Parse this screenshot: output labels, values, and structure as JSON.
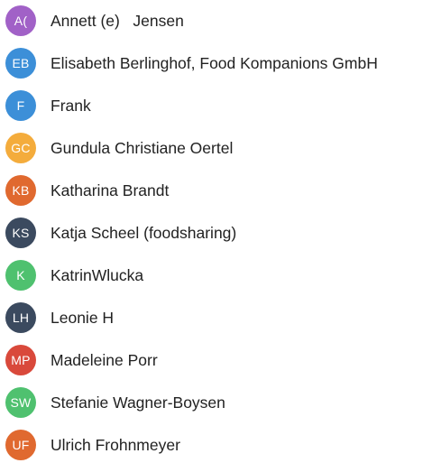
{
  "contacts": [
    {
      "initials": "A(",
      "name": "Annett (e)   Jensen",
      "color": "#a161c7"
    },
    {
      "initials": "EB",
      "name": "Elisabeth Berlinghof, Food Kompanions GmbH",
      "color": "#3c8fd8"
    },
    {
      "initials": "F",
      "name": "Frank",
      "color": "#3c8fd8"
    },
    {
      "initials": "GC",
      "name": "Gundula Christiane Oertel",
      "color": "#f4ac3c"
    },
    {
      "initials": "KB",
      "name": "Katharina Brandt",
      "color": "#e0692f"
    },
    {
      "initials": "KS",
      "name": "Katja Scheel (foodsharing)",
      "color": "#3b4a5f"
    },
    {
      "initials": "K",
      "name": "KatrinWlucka",
      "color": "#4fc16f"
    },
    {
      "initials": "LH",
      "name": "Leonie H",
      "color": "#3b4a5f"
    },
    {
      "initials": "MP",
      "name": "Madeleine Porr",
      "color": "#d9493b"
    },
    {
      "initials": "SW",
      "name": "Stefanie Wagner-Boysen",
      "color": "#4fc16f"
    },
    {
      "initials": "UF",
      "name": "Ulrich Frohnmeyer",
      "color": "#e0692f"
    }
  ]
}
